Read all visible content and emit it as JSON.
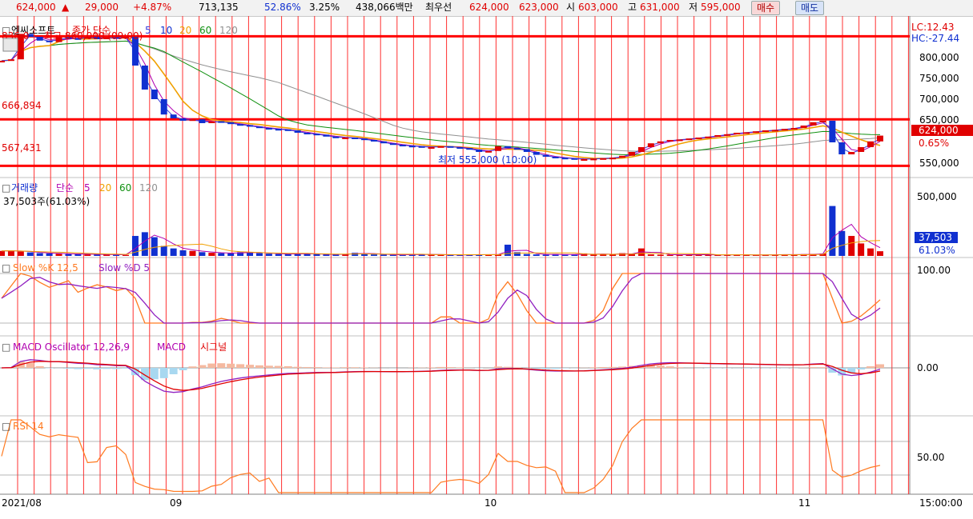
{
  "ticker_bar": {
    "price": "624,000",
    "arrow": "▲",
    "change": "29,000",
    "change_pct": "+4.87%",
    "volume": "713,135",
    "ratio1": "52.86%",
    "ratio2": "3.25%",
    "amount": "438,066백만",
    "best_label": "최우선",
    "best_ask": "624,000",
    "best_bid": "623,000",
    "open_label": "시",
    "open": "603,000",
    "high_label": "고",
    "high": "631,000",
    "low_label": "저",
    "low": "595,000",
    "buy_label": "매수",
    "sell_label": "매도"
  },
  "colors": {
    "up": "#e00000",
    "down": "#1030d0",
    "grid": "#ff3030",
    "ma5": "#3b3bdc",
    "ma10": "#b000b0",
    "ma20": "#f0a000",
    "ma60": "#109010",
    "ma120": "#909090",
    "stoch_k": "#ff7a20",
    "stoch_d": "#9020c0",
    "macd_fill_pos": "#f5b9a0",
    "macd_fill_neg": "#a8d8f0",
    "rsi": "#ff7a20"
  },
  "price_panel": {
    "title_icon": "□",
    "name": "엔씨소프트",
    "ma_label": "종가 단순",
    "ma_periods": [
      "5",
      "10",
      "20",
      "60",
      "120"
    ],
    "hi_note": "최고 860,000 (09:00)",
    "hi_prefix": "836,0",
    "low_note": "최저 555,000 (10:00)",
    "lc": "LC:12.43",
    "hc": "HC:-27.44",
    "level_high": "666,894",
    "level_low": "567,431",
    "current_price": "624,000",
    "current_pct": "0.65%",
    "y_ticks": [
      "800,000",
      "750,000",
      "700,000",
      "650,000",
      "550,000"
    ],
    "hlines": [
      831000,
      658000,
      561000
    ]
  },
  "volume_panel": {
    "label": "거래량",
    "ma_label": "단순",
    "ma_periods": [
      "5",
      "20",
      "60",
      "120"
    ],
    "value_note": "37,503주(61.03%)",
    "y_tick": "500,000",
    "current": "37,503",
    "current_pct": "61.03%"
  },
  "stoch_panel": {
    "label_k": "Slow %K 12,5",
    "label_d": "Slow %D 5",
    "y_tick": "100.00"
  },
  "macd_panel": {
    "label_osc": "MACD Oscillator 12,26,9",
    "label_macd": "MACD",
    "label_signal": "시그널",
    "y_tick": "0.00"
  },
  "rsi_panel": {
    "label": "RSI 14",
    "y_tick": "50.00"
  },
  "x_axis": {
    "labels": [
      {
        "text": "2021/08",
        "pos": 0.0
      },
      {
        "text": "09",
        "pos": 0.19
      },
      {
        "text": "10",
        "pos": 0.548
      },
      {
        "text": "11",
        "pos": 0.9
      }
    ],
    "time": "15:00:00"
  },
  "chart_data": {
    "type": "line",
    "series": [
      {
        "name": "종가",
        "values": [
          780000,
          783000,
          836000,
          830000,
          822000,
          819000,
          829000,
          827000,
          826000,
          830000,
          825000,
          829000,
          827000,
          830000,
          770000,
          720000,
          700000,
          668000,
          660000,
          655000,
          658000,
          650000,
          654000,
          652000,
          648000,
          646000,
          643000,
          640000,
          638000,
          637000,
          635000,
          630000,
          628000,
          626000,
          622000,
          620000,
          620000,
          618000,
          615000,
          612000,
          608000,
          605000,
          603000,
          602000,
          600000,
          600000,
          602000,
          600000,
          598000,
          595000,
          590000,
          592000,
          602000,
          598000,
          596000,
          590000,
          584000,
          580000,
          578000,
          577000,
          575000,
          575000,
          576000,
          577000,
          578000,
          582000,
          590000,
          600000,
          608000,
          612000,
          615000,
          616000,
          618000,
          620000,
          622000,
          625000,
          627000,
          630000,
          631000,
          633000,
          635000,
          636000,
          638000,
          640000,
          645000,
          652000,
          655000,
          610000,
          585000,
          590000,
          600000,
          612000,
          624000
        ]
      }
    ],
    "volume_series": [
      40000,
      42000,
      35000,
      28000,
      22000,
      20000,
      18000,
      15000,
      14000,
      13000,
      12000,
      10000,
      9000,
      8500,
      160000,
      190000,
      150000,
      80000,
      60000,
      45000,
      40000,
      30000,
      25000,
      22000,
      20000,
      30000,
      28000,
      22000,
      18000,
      15000,
      14000,
      20000,
      16000,
      13000,
      12000,
      11000,
      15000,
      25000,
      18000,
      12000,
      10000,
      9000,
      8000,
      12000,
      14000,
      10000,
      9000,
      8000,
      7000,
      9000,
      12000,
      10000,
      11000,
      90000,
      30000,
      15000,
      12000,
      10000,
      14000,
      9000,
      11000,
      20000,
      10000,
      16000,
      12000,
      22000,
      14000,
      60000,
      12000,
      10000,
      9000,
      8000,
      11000,
      9000,
      8000,
      7000,
      10000,
      9000,
      8000,
      7000,
      9000,
      10000,
      12000,
      9000,
      14000,
      16000,
      18000,
      400000,
      200000,
      160000,
      100000,
      60000,
      37503
    ],
    "ylim": [
      540000,
      860000
    ]
  }
}
